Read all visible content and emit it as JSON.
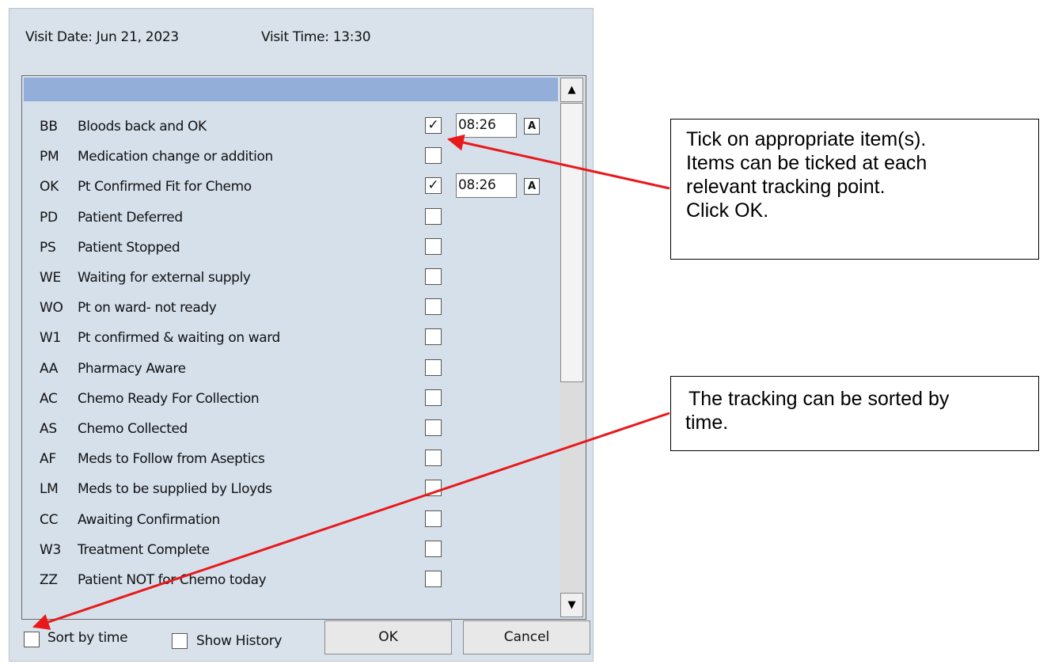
{
  "visit": {
    "date_label": "Visit Date: Jun 21, 2023",
    "time_label": "Visit Time: 13:30"
  },
  "tracking_items": [
    {
      "code": "BB",
      "label": "Bloods back and OK",
      "checked": true,
      "time": "08:26",
      "auto_btn": "A"
    },
    {
      "code": "PM",
      "label": "Medication change or addition",
      "checked": false
    },
    {
      "code": "OK",
      "label": "Pt Confirmed Fit for Chemo",
      "checked": true,
      "time": "08:26",
      "auto_btn": "A"
    },
    {
      "code": "PD",
      "label": "Patient Deferred",
      "checked": false
    },
    {
      "code": "PS",
      "label": "Patient Stopped",
      "checked": false
    },
    {
      "code": "WE",
      "label": "Waiting for external supply",
      "checked": false
    },
    {
      "code": "WO",
      "label": "Pt on ward- not ready",
      "checked": false
    },
    {
      "code": "W1",
      "label": "Pt confirmed & waiting on ward",
      "checked": false
    },
    {
      "code": "AA",
      "label": "Pharmacy Aware",
      "checked": false
    },
    {
      "code": "AC",
      "label": "Chemo Ready For Collection",
      "checked": false
    },
    {
      "code": "AS",
      "label": "Chemo Collected",
      "checked": false
    },
    {
      "code": "AF",
      "label": "Meds to Follow from Aseptics",
      "checked": false
    },
    {
      "code": "LM",
      "label": "Meds to be supplied by Lloyds",
      "checked": false
    },
    {
      "code": "CC",
      "label": "Awaiting Confirmation",
      "checked": false
    },
    {
      "code": "W3",
      "label": "Treatment Complete",
      "checked": false
    },
    {
      "code": "ZZ",
      "label": "Patient NOT for Chemo today",
      "checked": false
    }
  ],
  "footer": {
    "sort_by_time_label": "Sort by time",
    "sort_by_time_checked": false,
    "show_history_label": "Show History",
    "show_history_checked": false,
    "ok_label": "OK",
    "cancel_label": "Cancel"
  },
  "callouts": {
    "tick": {
      "lines": [
        "Tick on appropriate item(s).",
        "Items can be ticked at each",
        "relevant tracking point.",
        "Click OK."
      ]
    },
    "sort": {
      "lines": [
        "The tracking can be sorted by",
        "time."
      ]
    }
  },
  "colors": {
    "arrow": "#e8191b",
    "dialog_bg": "#d9e2eb",
    "list_header": "#93aed8"
  },
  "icons": {
    "scroll_up": "▲",
    "scroll_down": "▼",
    "check": "✓"
  }
}
